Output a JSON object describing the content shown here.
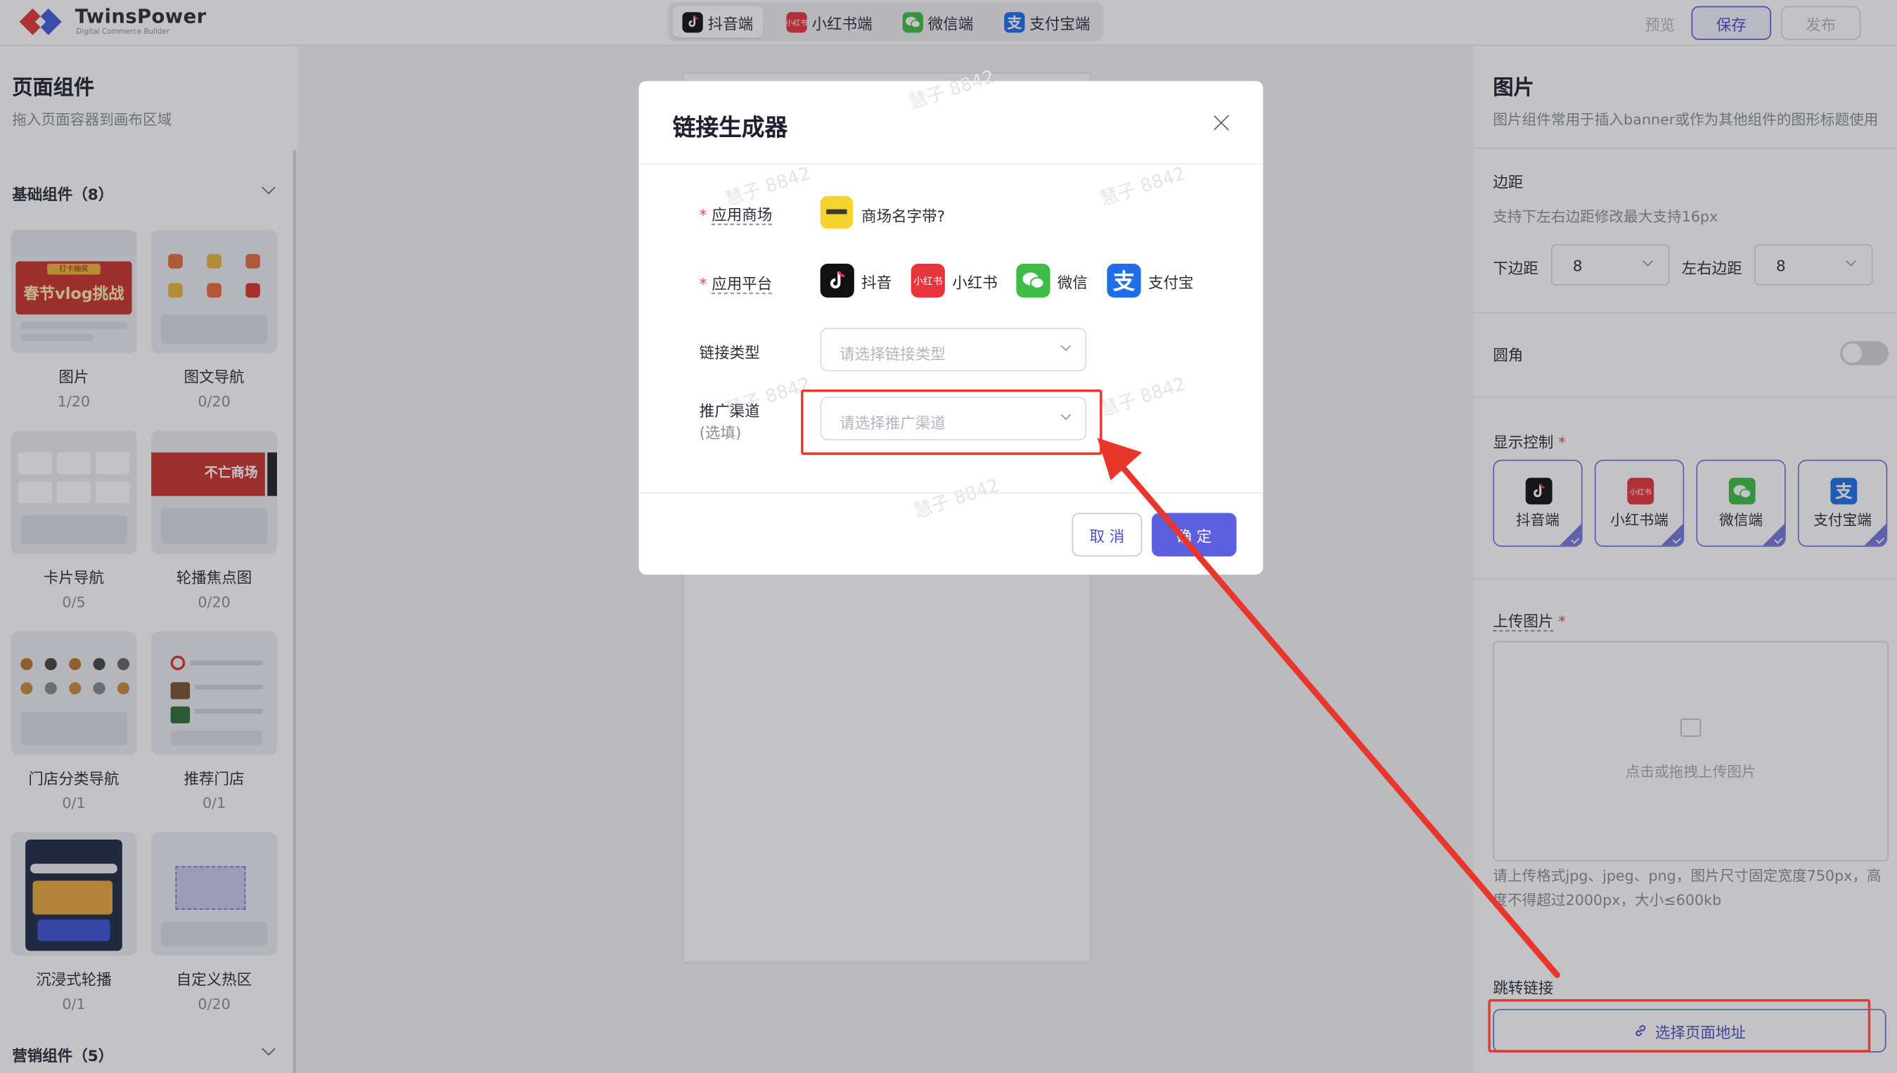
{
  "app": {
    "brand": "TwinsPower",
    "brand_sub": "Digital Commerce Builder"
  },
  "platform_tabs": [
    {
      "label": "抖音端",
      "icon": "douyin-icon",
      "color": "#111111",
      "active": true
    },
    {
      "label": "小红书端",
      "icon": "xiaohongshu-icon",
      "color": "#e8343c",
      "active": false
    },
    {
      "label": "微信端",
      "icon": "wechat-icon",
      "color": "#3dbd45",
      "active": false
    },
    {
      "label": "支付宝端",
      "icon": "alipay-icon",
      "color": "#1f6ee8",
      "active": false
    }
  ],
  "toolbar": {
    "preview_label": "预览",
    "save_label": "保存",
    "publish_label": "发布"
  },
  "left_panel": {
    "title": "页面组件",
    "subtitle": "拖入页面容器到画布区域",
    "basic_section": "基础组件（8）",
    "marketing_section": "营销组件（5）",
    "components": [
      {
        "name": "图片",
        "count": "1/20"
      },
      {
        "name": "图文导航",
        "count": "0/20"
      },
      {
        "name": "卡片导航",
        "count": "0/5"
      },
      {
        "name": "轮播焦点图",
        "count": "0/20"
      },
      {
        "name": "门店分类导航",
        "count": "0/1"
      },
      {
        "name": "推荐门店",
        "count": "0/1"
      },
      {
        "name": "沉浸式轮播",
        "count": "0/1"
      },
      {
        "name": "自定义热区",
        "count": "0/20"
      }
    ],
    "thumb_text": {
      "banner": "春节vlog挑战",
      "banner_top": "打卡抽奖",
      "hot": "不亡商场"
    }
  },
  "right_panel": {
    "title": "图片",
    "subtitle": "图片组件常用于插入banner或作为其他组件的图形标题使用",
    "margin_label": "边距",
    "margin_hint": "支持下左右边距修改最大支持16px",
    "bottom_margin_label": "下边距",
    "bottom_margin_value": "8",
    "side_margin_label": "左右边距",
    "side_margin_value": "8",
    "radius_label": "圆角",
    "radius_on": false,
    "display_label": "显示控制",
    "display_items": [
      {
        "label": "抖音端",
        "icon": "douyin-icon",
        "checked": true
      },
      {
        "label": "小红书端",
        "icon": "xiaohongshu-icon",
        "checked": true
      },
      {
        "label": "微信端",
        "icon": "wechat-icon",
        "checked": true
      },
      {
        "label": "支付宝端",
        "icon": "alipay-icon",
        "checked": true
      }
    ],
    "upload_label": "上传图片",
    "upload_placeholder": "点击或拖拽上传图片",
    "upload_hint": "请上传格式jpg、jpeg、png，图片尺寸固定宽度750px，高度不得超过2000px，大小≤600kb",
    "jump_label": "跳转链接",
    "jump_button": "选择页面地址"
  },
  "modal": {
    "title": "链接生成器",
    "mall_label": "应用商场",
    "mall_value": "商场名字带?",
    "platform_label": "应用平台",
    "platforms": [
      {
        "label": "抖音",
        "icon": "douyin-icon"
      },
      {
        "label": "小红书",
        "icon": "xiaohongshu-icon"
      },
      {
        "label": "微信",
        "icon": "wechat-icon"
      },
      {
        "label": "支付宝",
        "icon": "alipay-icon"
      }
    ],
    "link_type_label": "链接类型",
    "link_type_placeholder": "请选择链接类型",
    "channel_label": "推广渠道",
    "channel_optional": "(选填)",
    "channel_placeholder": "请选择推广渠道",
    "cancel_label": "取 消",
    "confirm_label": "确 定"
  },
  "watermark": "慧子 8842",
  "colors": {
    "primary": "#5b5fe0",
    "annotation": "#e8362d",
    "douyin": "#111111",
    "xiaohongshu": "#e8343c",
    "wechat": "#3dbd45",
    "alipay": "#1f6ee8"
  }
}
